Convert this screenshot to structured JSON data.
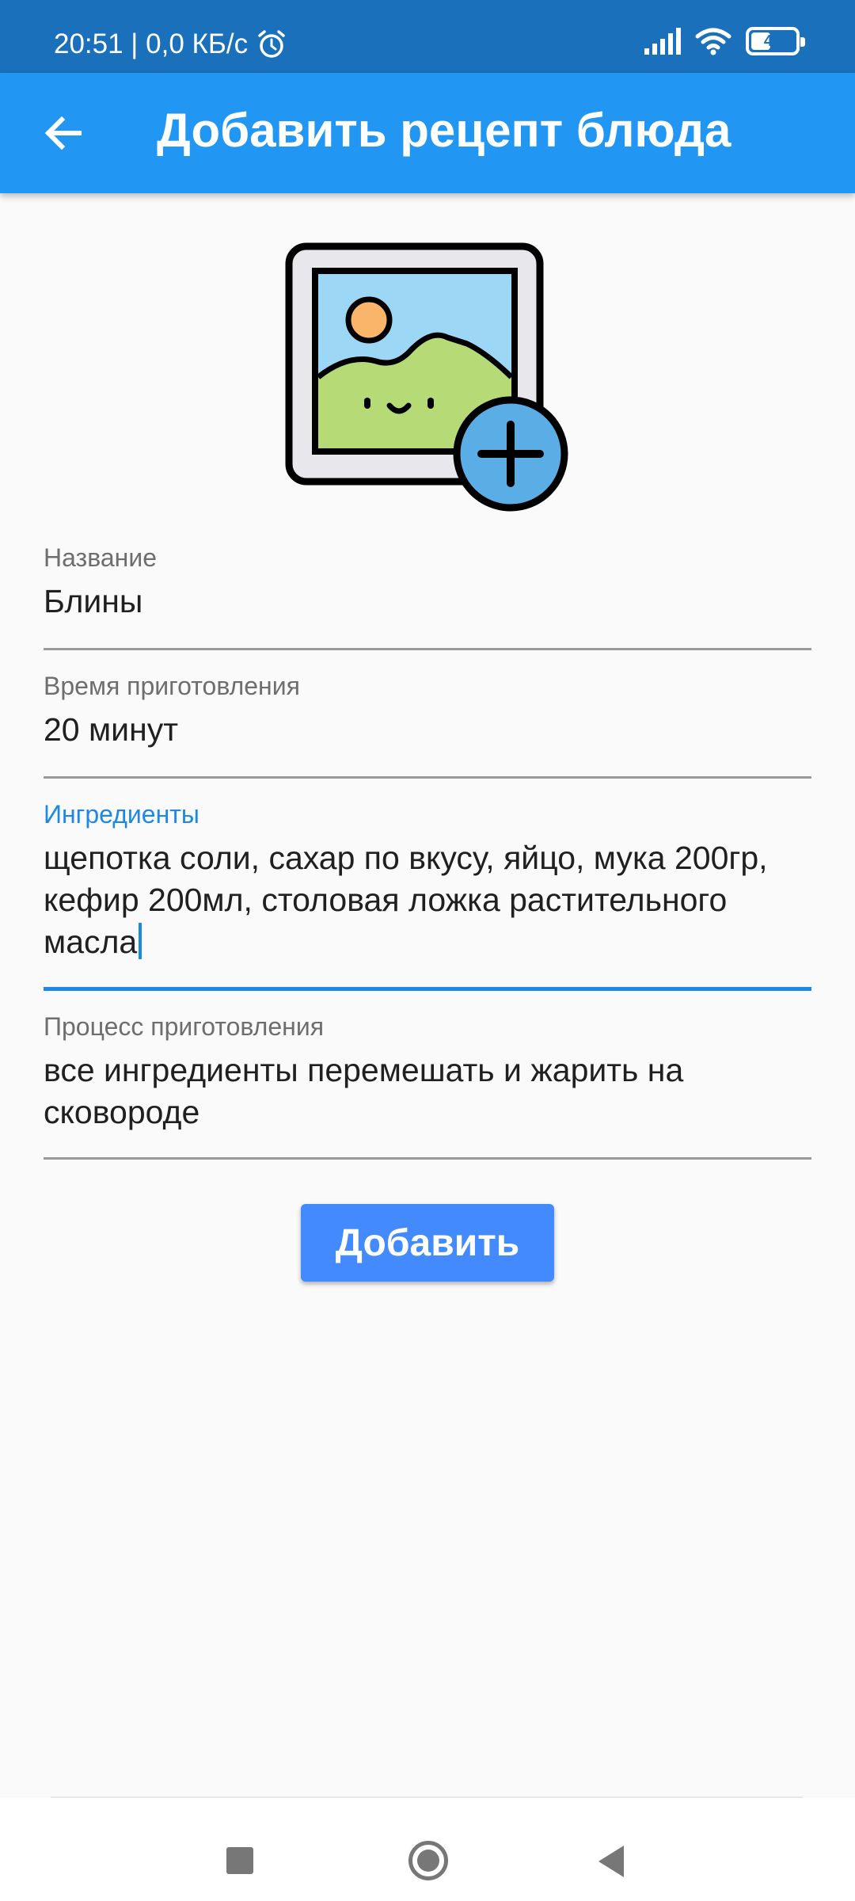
{
  "status_bar": {
    "time_speed": "20:51 | 0,0 КБ/с",
    "battery_level": "40",
    "icons": [
      "alarm-icon",
      "signal-icon",
      "wifi-icon",
      "battery-icon"
    ]
  },
  "app_bar": {
    "title": "Добавить рецепт блюда",
    "back_icon": "arrow-back-icon"
  },
  "image_picker": {
    "icon": "add-image-icon"
  },
  "form": {
    "name": {
      "label": "Название",
      "value": "Блины"
    },
    "cook_time": {
      "label": "Время приготовления",
      "value": "20 минут"
    },
    "ingredients": {
      "label": "Ингредиенты",
      "value": "щепотка соли, сахар по вкусу, яйцо, мука 200гр, кефир 200мл, столовая ложка растительного масла"
    },
    "process": {
      "label": "Процесс приготовления",
      "value": "все ингредиенты перемешать и жарить на сковороде"
    }
  },
  "submit": {
    "label": "Добавить"
  },
  "colors": {
    "status_bar": "#1a70bb",
    "app_bar": "#2196f3",
    "accent": "#1e88e5",
    "button": "#448aff"
  }
}
